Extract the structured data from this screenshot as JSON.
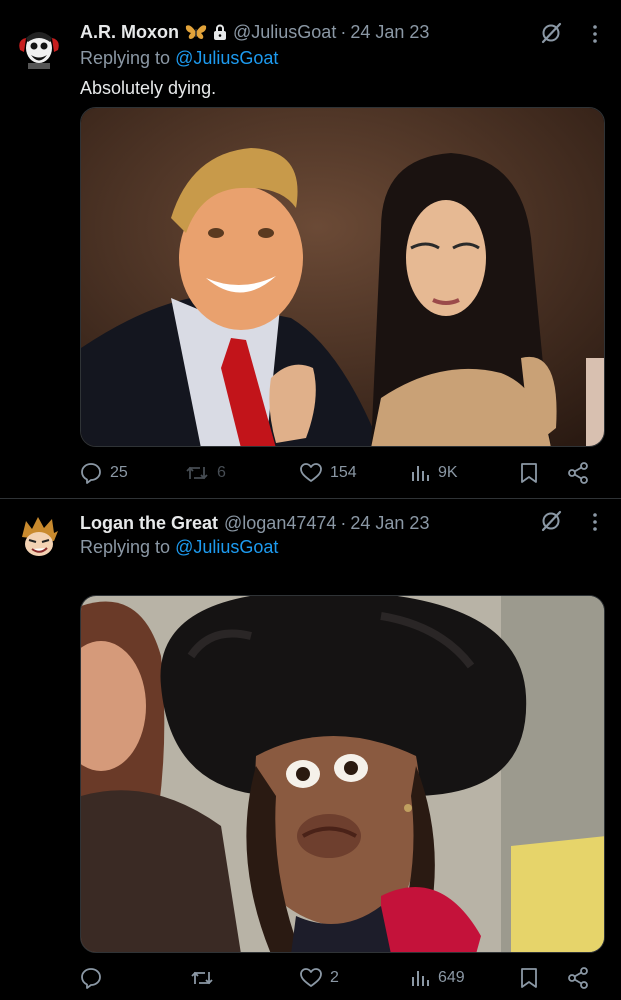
{
  "tweets": [
    {
      "author_name": "A.R. Moxon",
      "handle": "@JuliusGoat",
      "separator": "·",
      "date": "24 Jan 23",
      "replying_prefix": "Replying to",
      "replying_to": "@JuliusGoat",
      "text": "Absolutely dying.",
      "counts": {
        "replies": "25",
        "retweets": "6",
        "likes": "154",
        "views": "9K"
      }
    },
    {
      "author_name": "Logan the Great",
      "handle": "@logan47474",
      "separator": "·",
      "date": "24 Jan 23",
      "replying_prefix": "Replying to",
      "replying_to": "@JuliusGoat",
      "text": "",
      "counts": {
        "replies": "",
        "retweets": "",
        "likes": "2",
        "views": "649"
      }
    }
  ],
  "colors": {
    "background": "#000000",
    "text": "#e7e9ea",
    "muted": "#8b98a5",
    "link": "#1d9bf0",
    "divider": "#2f3336"
  },
  "icons": [
    "butterfly-icon",
    "lock-icon",
    "grok-icon",
    "more-icon",
    "reply-icon",
    "retweet-icon",
    "like-icon",
    "views-icon",
    "bookmark-icon",
    "share-icon"
  ]
}
